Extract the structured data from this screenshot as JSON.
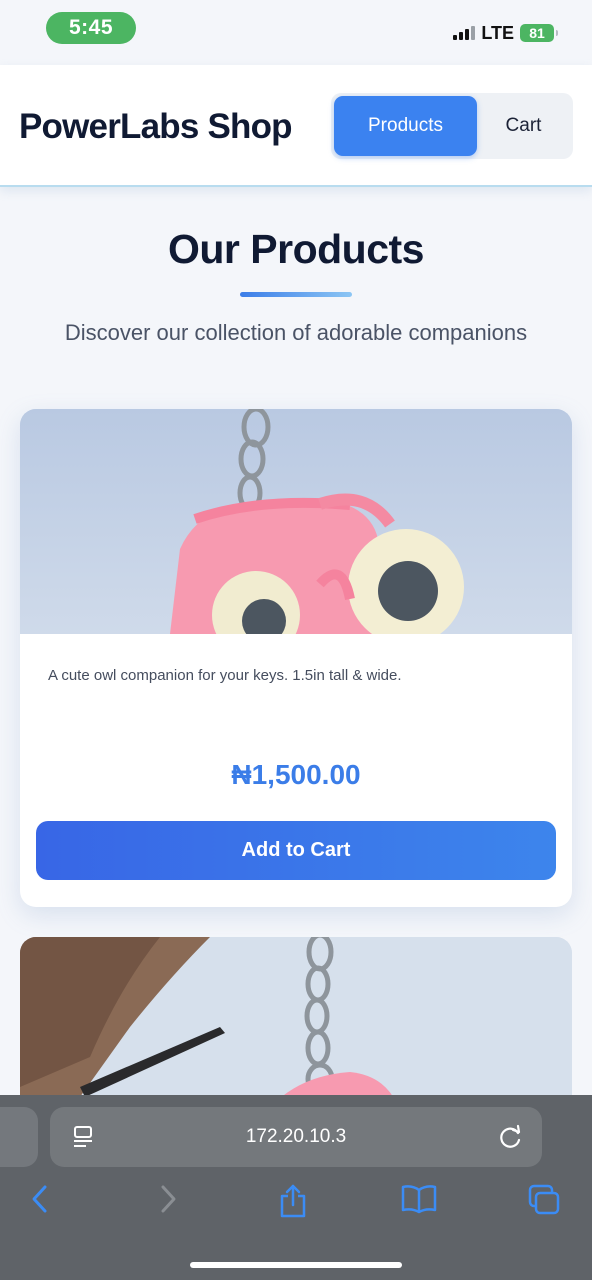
{
  "status_bar": {
    "time": "5:45",
    "network": "LTE",
    "battery": "81"
  },
  "header": {
    "brand": "PowerLabs Shop",
    "nav": {
      "products": "Products",
      "cart": "Cart"
    }
  },
  "section": {
    "title": "Our Products",
    "subtitle": "Discover our collection of adorable companions"
  },
  "products": [
    {
      "description": "A cute owl companion for your keys. 1.5in tall & wide.",
      "price": "₦1,500.00",
      "button_label": "Add to Cart"
    }
  ],
  "browser": {
    "url": "172.20.10.3"
  },
  "icons": {
    "reader": "reader-mode-icon",
    "reload": "reload-icon",
    "back": "chevron-left-icon",
    "forward": "chevron-right-icon",
    "share": "share-icon",
    "bookmarks": "book-icon",
    "tabs": "tabs-icon"
  },
  "colors": {
    "accent": "#3b82f0",
    "price": "#3b7de8",
    "time_pill": "#4cb562",
    "browser_bar": "#5f6368",
    "toolbar_icon": "#3b8cf5"
  }
}
